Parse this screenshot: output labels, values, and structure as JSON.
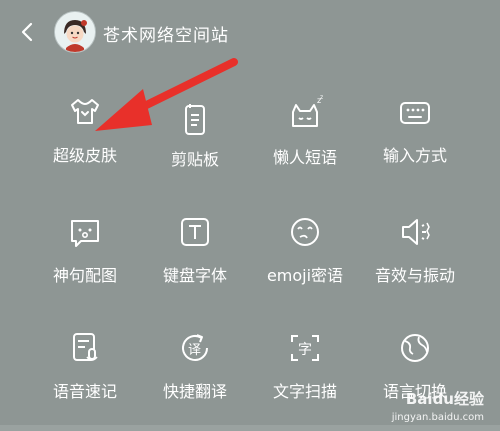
{
  "header": {
    "title": "苍术网络空间站",
    "back_icon": "chevron-left-icon",
    "avatar_icon": "cartoon-avatar-icon"
  },
  "tiles": [
    {
      "label": "超级皮肤",
      "icon": "tshirt-icon"
    },
    {
      "label": "剪贴板",
      "icon": "clipboard-icon"
    },
    {
      "label": "懒人短语",
      "icon": "sleepy-cat-icon"
    },
    {
      "label": "输入方式",
      "icon": "keyboard-icon"
    },
    {
      "label": "神句配图",
      "icon": "image-bubble-icon"
    },
    {
      "label": "键盘字体",
      "icon": "font-t-icon"
    },
    {
      "label": "emoji密语",
      "icon": "emoji-icon"
    },
    {
      "label": "音效与振动",
      "icon": "speaker-icon"
    },
    {
      "label": "语音速记",
      "icon": "voice-note-icon"
    },
    {
      "label": "快捷翻译",
      "icon": "translate-icon"
    },
    {
      "label": "文字扫描",
      "icon": "scan-text-icon"
    },
    {
      "label": "语言切换",
      "icon": "globe-icon"
    }
  ],
  "watermark": {
    "brand": "Baidu经验",
    "url": "jingyan.baidu.com"
  },
  "colors": {
    "background": "#8e9694",
    "arrow": "#e8302a",
    "foreground": "#ffffff"
  }
}
